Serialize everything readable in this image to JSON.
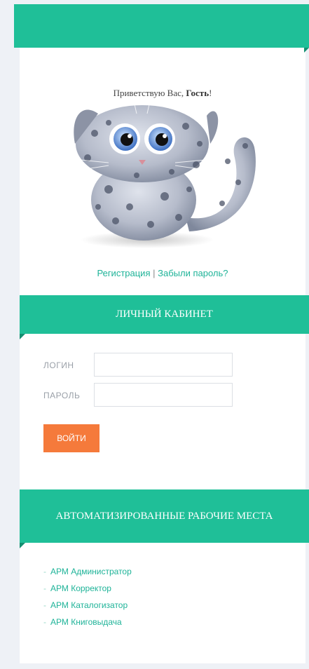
{
  "greeting": {
    "prefix": "Приветствую Вас,",
    "user": "Гость",
    "suffix": "!"
  },
  "auth_links": {
    "register": "Регистрация",
    "separator": "|",
    "forgot": "Забыли пароль?"
  },
  "cabinet": {
    "title": "ЛИЧНЫЙ КАБИНЕТ",
    "login_label": "ЛОГИН",
    "login_value": "",
    "password_label": "ПАРОЛЬ",
    "password_value": "",
    "submit_label": "ВОЙТИ"
  },
  "arm": {
    "title": "АВТОМАТИЗИРОВАННЫЕ РАБОЧИЕ МЕСТА",
    "items": [
      {
        "label": "АРМ Администратор"
      },
      {
        "label": "АРМ Корректор"
      },
      {
        "label": "АРМ Каталогизатор"
      },
      {
        "label": "АРМ Книговыдача"
      }
    ]
  },
  "colors": {
    "accent": "#1fbf98",
    "accent_dark": "#158f71",
    "button": "#f57a3b",
    "link": "#1eb398",
    "page_bg": "#eef1f6"
  }
}
